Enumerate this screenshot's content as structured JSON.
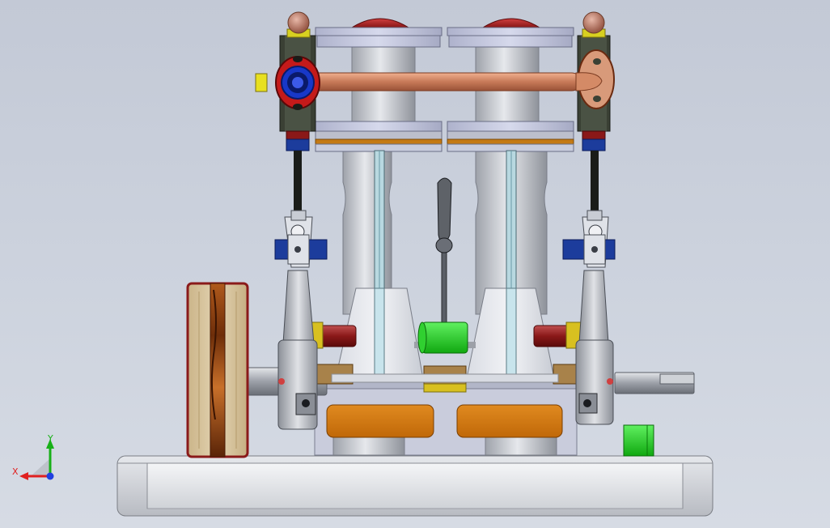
{
  "viewport": {
    "background_top": "#c3c9d6",
    "background_bottom": "#d6dbe4"
  },
  "triad": {
    "x_label": "X",
    "y_label": "Y",
    "x_color": "#e02020",
    "y_color": "#18b018",
    "z_color": "#2040e0"
  },
  "model": {
    "colors": {
      "steel": "#c8ccd4",
      "cylinder_cover": "#c4c8de",
      "copper_pipe": "#d08a6a",
      "valve_red": "#c41a1a",
      "valve_blue": "#1838c8",
      "port_orange": "#d47a10",
      "lever_green": "#20d020",
      "small_block_green": "#10c010",
      "bearing_blue": "#1c3c9c",
      "wood": "#d9c7a0",
      "crank_red": "#8a1818",
      "brass": "#d8c020"
    }
  }
}
